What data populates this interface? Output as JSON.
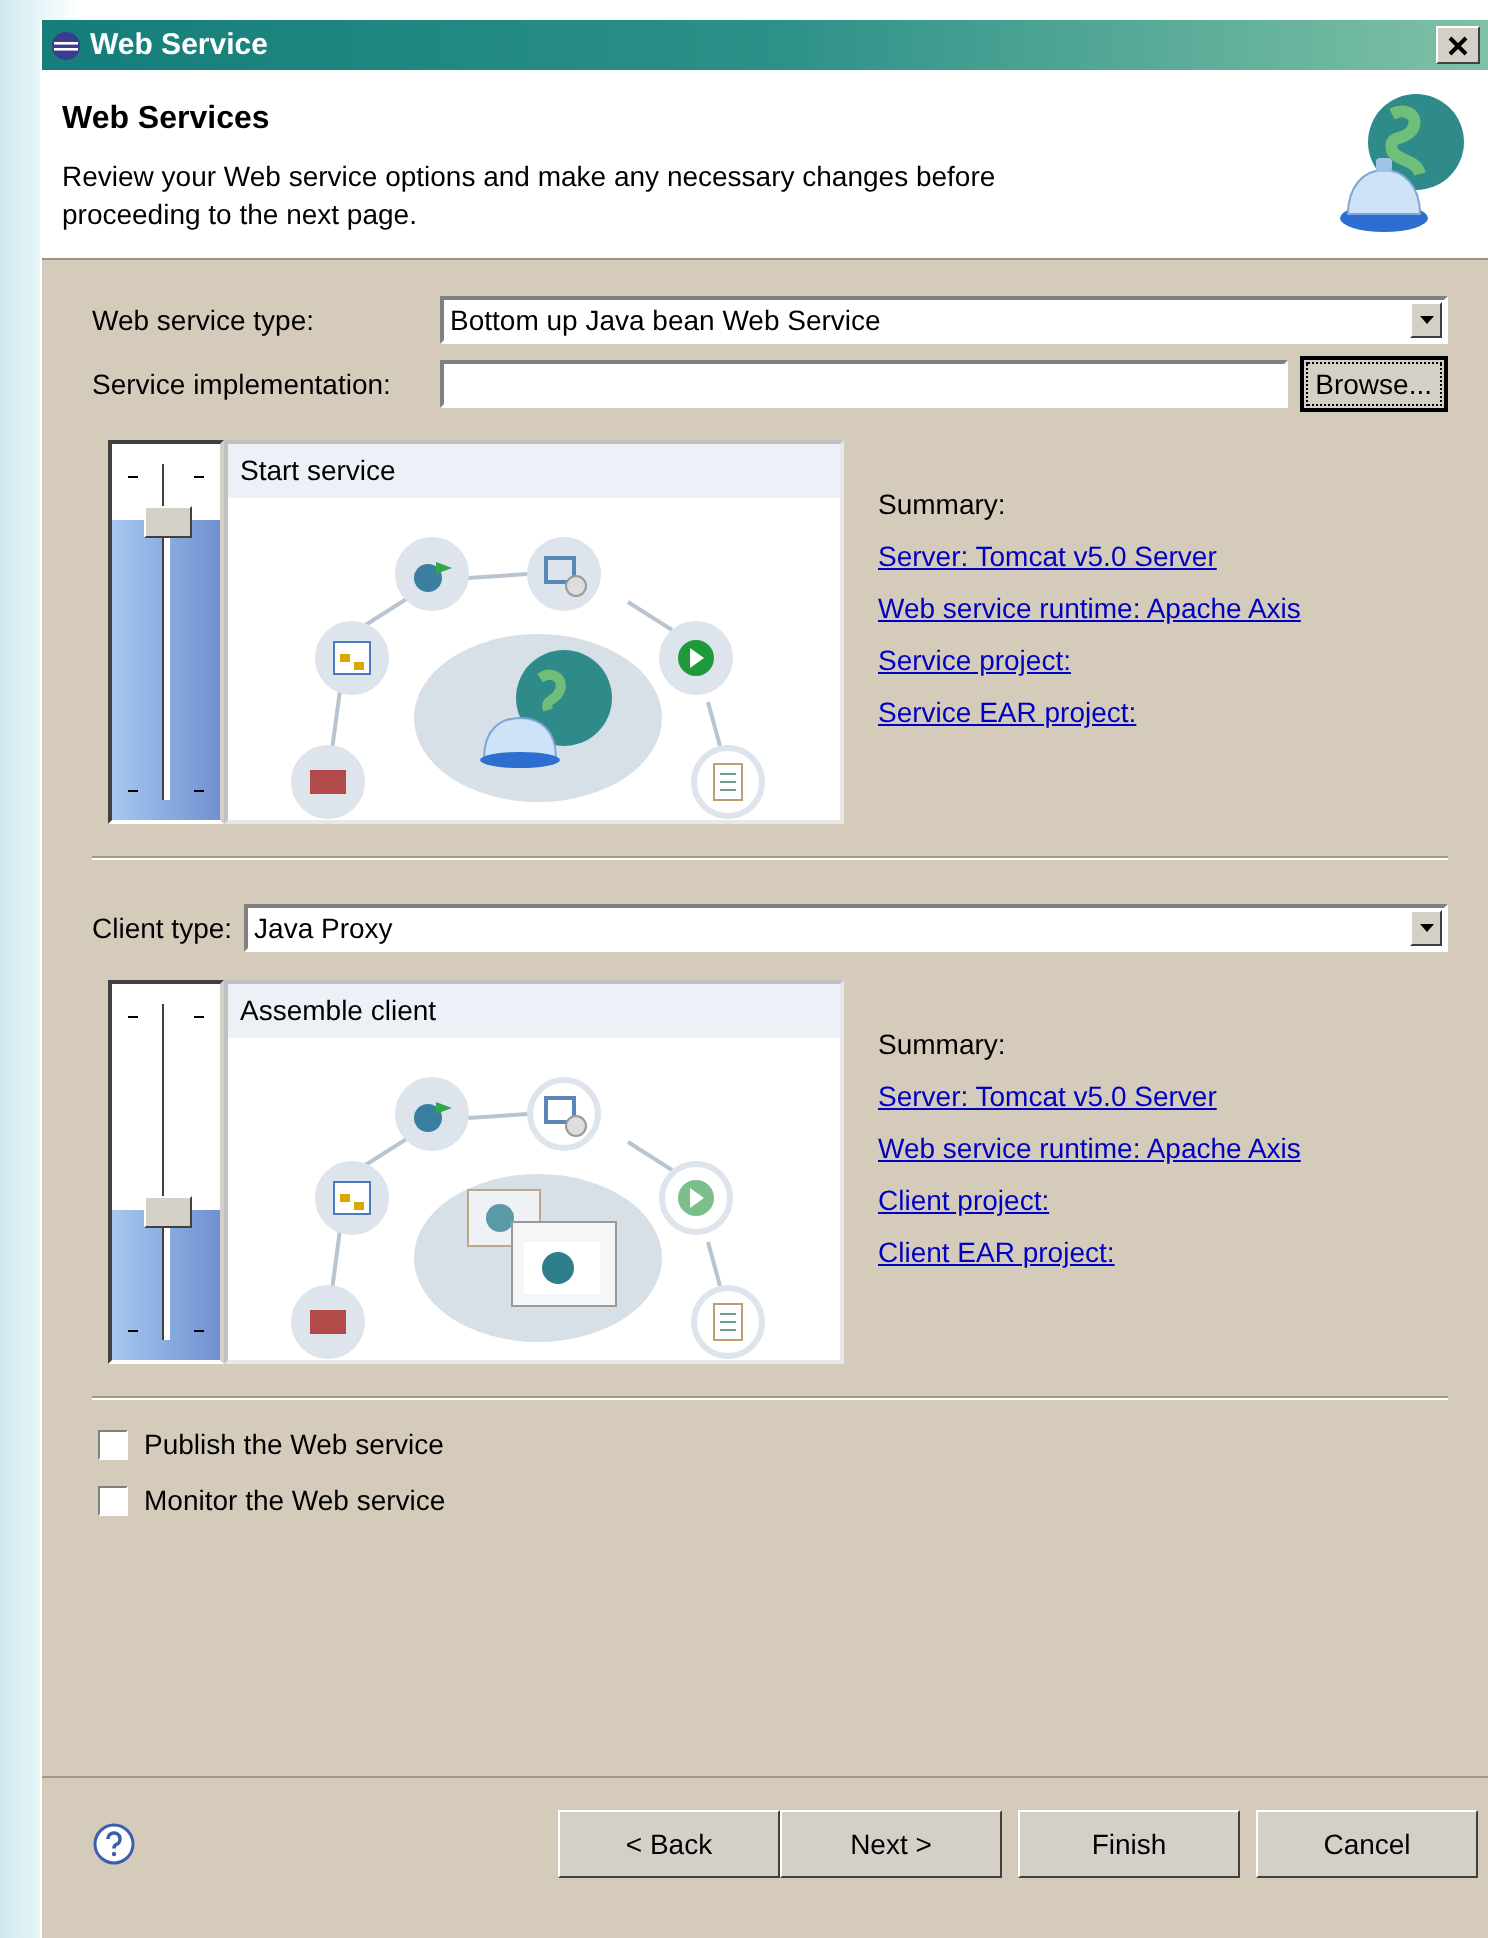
{
  "window": {
    "title": "Web Service"
  },
  "header": {
    "title": "Web Services",
    "description": "Review your Web service options and make any necessary changes before proceeding to the next page."
  },
  "service": {
    "type_label": "Web service type:",
    "type_value": "Bottom up Java bean Web Service",
    "impl_label": "Service implementation:",
    "browse": "Browse...",
    "slider": {
      "level": 0.8
    },
    "stage_title": "Start service",
    "kind": "service",
    "summary_label": "Summary:",
    "links": [
      "Server: Tomcat v5.0 Server",
      "Web service runtime: Apache Axis",
      "Service project:",
      "Service EAR project:"
    ]
  },
  "client": {
    "type_label": "Client type:",
    "type_value": "Java Proxy",
    "slider": {
      "level": 0.4
    },
    "stage_title": "Assemble client",
    "kind": "client",
    "summary_label": "Summary:",
    "links": [
      "Server: Tomcat v5.0 Server",
      "Web service runtime: Apache Axis",
      "Client project:",
      "Client EAR project:"
    ]
  },
  "options": [
    {
      "label": "Publish the Web service",
      "checked": false
    },
    {
      "label": "Monitor the Web service",
      "checked": false
    }
  ],
  "buttons": [
    "< Back",
    "Next >",
    "Finish",
    "Cancel"
  ]
}
